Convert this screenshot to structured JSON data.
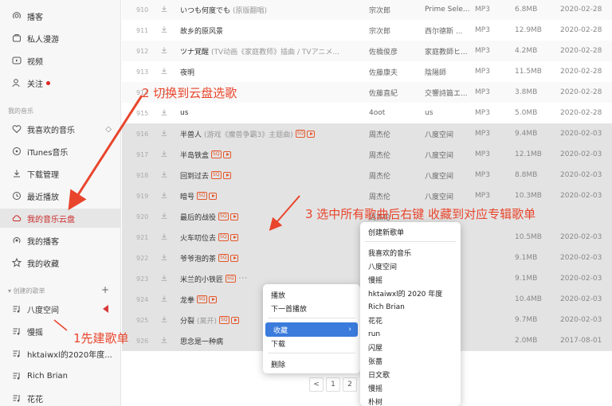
{
  "sidebar": {
    "top_items": [
      {
        "label": "播客",
        "icon": "podcast-icon"
      },
      {
        "label": "私人漫游",
        "icon": "roam-icon"
      },
      {
        "label": "视频",
        "icon": "video-icon"
      },
      {
        "label": "关注",
        "icon": "follow-icon"
      }
    ],
    "my_music_heading": "我的音乐",
    "my_music": [
      {
        "label": "我喜欢的音乐",
        "icon": "heart-icon"
      },
      {
        "label": "iTunes音乐",
        "icon": "itunes-icon"
      },
      {
        "label": "下载管理",
        "icon": "download-icon"
      },
      {
        "label": "最近播放",
        "icon": "history-icon"
      },
      {
        "label": "我的音乐云盘",
        "icon": "cloud-icon"
      },
      {
        "label": "我的播客",
        "icon": "podcast-icon"
      },
      {
        "label": "我的收藏",
        "icon": "star-icon"
      }
    ],
    "created_heading": "创建的歌单",
    "playlists": [
      {
        "label": "八度空间"
      },
      {
        "label": "慢摇"
      },
      {
        "label": "hktaiwxl的2020年度..."
      },
      {
        "label": "Rich Brian"
      },
      {
        "label": "花花"
      }
    ]
  },
  "table": {
    "rows": [
      {
        "num": "910",
        "title": "いつも何度でも",
        "sub": "(原版翻唱)",
        "artist": "宗次郎",
        "album": "Prime Sele...",
        "fmt": "MP3",
        "size": "6.8MB",
        "date": "2020-02-28",
        "sq": false,
        "mv": false
      },
      {
        "num": "911",
        "title": "故乡的原风景",
        "sub": "",
        "artist": "宗次郎",
        "album": "西尔德斯 ...",
        "fmt": "MP3",
        "size": "12.9MB",
        "date": "2020-02-28",
        "sq": false,
        "mv": false
      },
      {
        "num": "912",
        "title": "ツナ覚醒",
        "sub": "(TV动画《家庭教师》插曲 / TVアニメ...",
        "artist": "佐橋俊彦",
        "album": "家庭教師ヒ...",
        "fmt": "MP3",
        "size": "4.2MB",
        "date": "2020-02-28",
        "sq": false,
        "mv": false
      },
      {
        "num": "913",
        "title": "夜明",
        "sub": "",
        "artist": "佐藤康夫",
        "album": "陰陽師",
        "fmt": "MP3",
        "size": "11.5MB",
        "date": "2020-02-28",
        "sq": false,
        "mv": false
      },
      {
        "num": "914",
        "title": "",
        "sub": "",
        "artist": "佐藤直紀",
        "album": "交響詩篇エ...",
        "fmt": "MP3",
        "size": "3.8MB",
        "date": "2020-02-28",
        "sq": false,
        "mv": false
      },
      {
        "num": "915",
        "title": "us",
        "sub": "",
        "artist": "4oot",
        "album": "us",
        "fmt": "MP3",
        "size": "5.0MB",
        "date": "2020-02-28",
        "sq": false,
        "mv": false
      },
      {
        "num": "916",
        "title": "半兽人",
        "sub": "(游戏《魔兽争霸3》主题曲)",
        "artist": "周杰伦",
        "album": "八度空间",
        "fmt": "MP3",
        "size": "9.4MB",
        "date": "2020-02-03",
        "sq": true,
        "mv": true
      },
      {
        "num": "917",
        "title": "半岛铁盒",
        "sub": "",
        "artist": "周杰伦",
        "album": "八度空间",
        "fmt": "MP3",
        "size": "12.1MB",
        "date": "2020-02-03",
        "sq": true,
        "mv": true
      },
      {
        "num": "918",
        "title": "回到过去",
        "sub": "",
        "artist": "周杰伦",
        "album": "八度空间",
        "fmt": "MP3",
        "size": "8.8MB",
        "date": "2020-02-03",
        "sq": true,
        "mv": true
      },
      {
        "num": "919",
        "title": "暗号",
        "sub": "",
        "artist": "周杰伦",
        "album": "八度空间",
        "fmt": "MP3",
        "size": "10.3MB",
        "date": "2020-02-03",
        "sq": true,
        "mv": true
      },
      {
        "num": "920",
        "title": "最后的战役",
        "sub": "",
        "artist": "周杰伦",
        "album": "",
        "fmt": "",
        "size": "",
        "date": "",
        "sq": true,
        "mv": true
      },
      {
        "num": "921",
        "title": "火车叨位去",
        "sub": "",
        "artist": "周杰伦",
        "album": "",
        "fmt": "",
        "size": "10.5MB",
        "date": "2020-02-03",
        "sq": true,
        "mv": true
      },
      {
        "num": "922",
        "title": "爷爷泡的茶",
        "sub": "",
        "artist": "周杰伦",
        "album": "",
        "fmt": "",
        "size": "9.1MB",
        "date": "2020-02-03",
        "sq": true,
        "mv": true
      },
      {
        "num": "923",
        "title": "米兰的小铁匠",
        "sub": "",
        "artist": "周杰伦",
        "album": "",
        "fmt": "",
        "size": "9.1MB",
        "date": "2020-02-03",
        "sq": true,
        "mv": false
      },
      {
        "num": "924",
        "title": "龙拳",
        "sub": "",
        "artist": "周杰伦",
        "album": "",
        "fmt": "",
        "size": "10.4MB",
        "date": "2020-02-03",
        "sq": true,
        "mv": true
      },
      {
        "num": "925",
        "title": "分裂",
        "sub": "(离开)",
        "artist": "周杰伦",
        "album": "",
        "fmt": "",
        "size": "9.7MB",
        "date": "2020-02-03",
        "sq": true,
        "mv": true
      },
      {
        "num": "926",
        "title": "思念是一种病",
        "sub": "",
        "artist": "",
        "album": "",
        "fmt": "",
        "size": "2.0MB",
        "date": "2017-08-01",
        "sq": false,
        "mv": false
      }
    ]
  },
  "pager": {
    "prev": "<",
    "p1": "1",
    "p2": "2"
  },
  "context_menu": {
    "play": "播放",
    "play_next": "下一首播放",
    "collect": "收藏",
    "download": "下载",
    "delete": "删除"
  },
  "submenu": {
    "create": "创建新歌单",
    "items": [
      "我喜欢的音乐",
      "八度空间",
      "慢摇",
      "hktaiwxl的 2020 年度",
      "Rich Brian",
      "花花",
      "run",
      "闪屋",
      "张蔷",
      "日文歌",
      "慢摇",
      "朴树"
    ]
  },
  "annotations": {
    "step1": "1先建歌单",
    "step2": "2 切换到云盘选歌",
    "step3": "3 选中所有歌曲后右键 收藏到对应专辑歌单"
  },
  "colors": {
    "accent_red": "#c92a2a",
    "annotation": "#e8452c",
    "menu_highlight": "#3a7bdc"
  }
}
